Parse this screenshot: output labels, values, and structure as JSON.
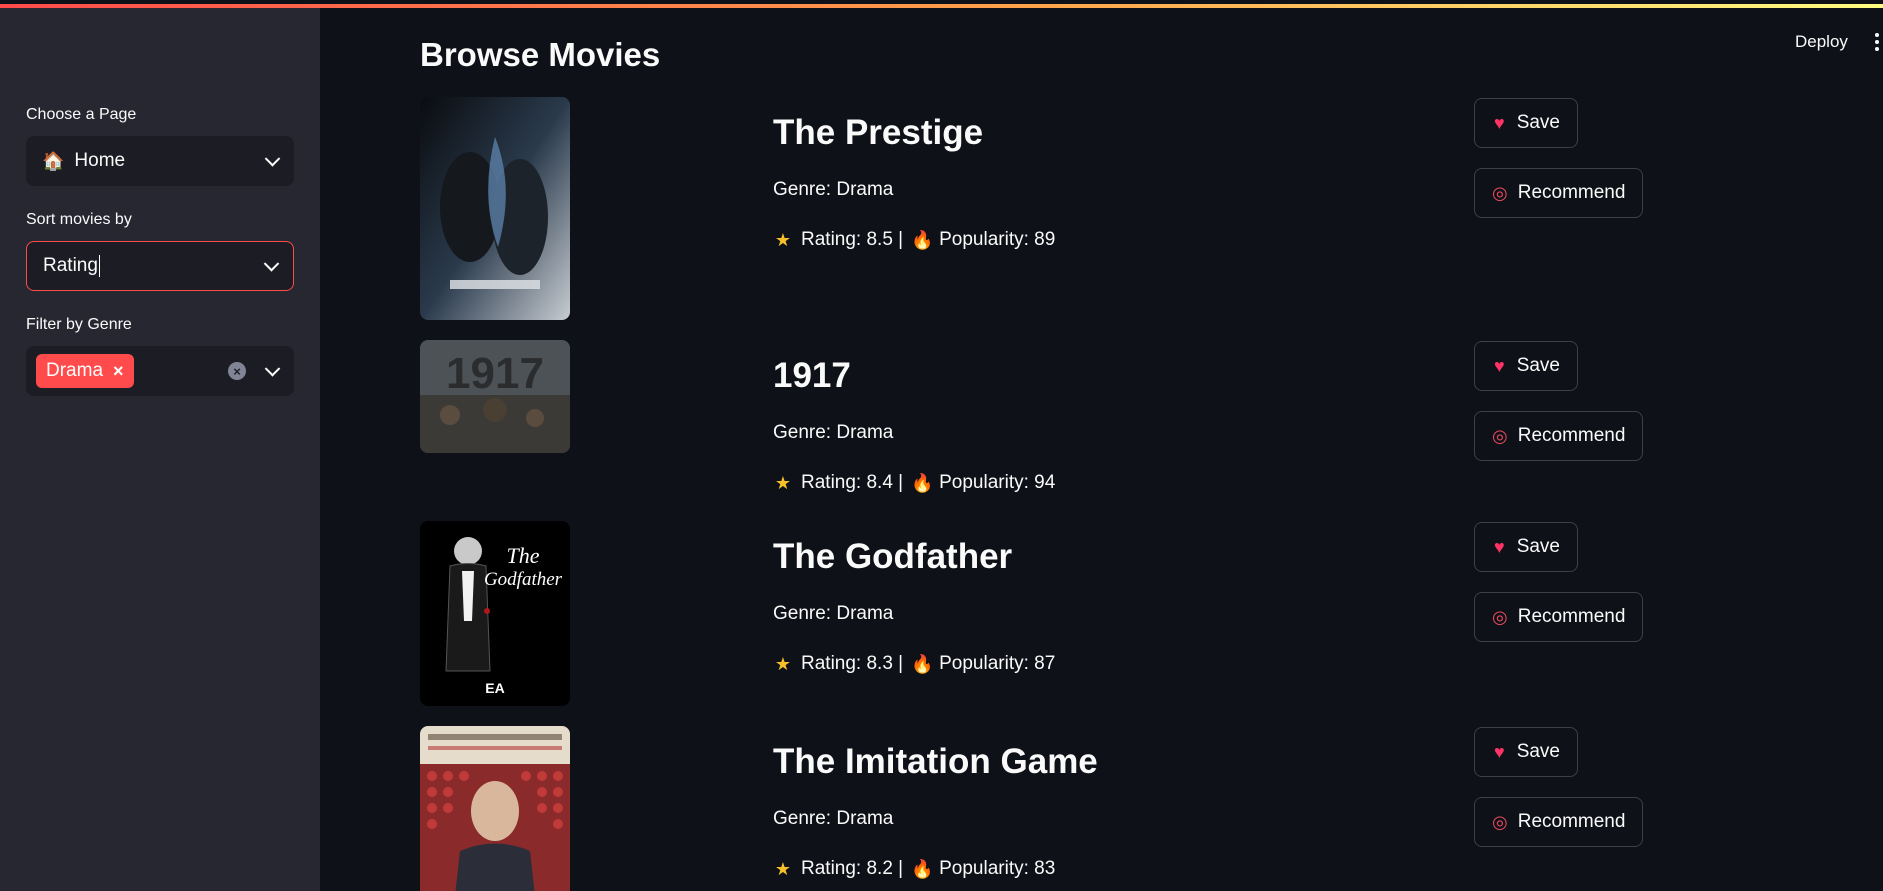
{
  "sidebar": {
    "page_label": "Choose a Page",
    "page_value": "Home",
    "page_icon": "house-icon",
    "sort_label": "Sort movies by",
    "sort_value": "Rating",
    "genre_label": "Filter by Genre",
    "genre_tag": "Drama",
    "genre_tag_remove": "×"
  },
  "header": {
    "title": "Browse Movies",
    "deploy_label": "Deploy"
  },
  "buttons": {
    "save_label": "Save",
    "recommend_label": "Recommend"
  },
  "movies": [
    {
      "title": "The Prestige",
      "genre": "Genre: Drama",
      "rating": "Rating: 8.5 |",
      "popularity": "Popularity: 89",
      "poster_accent": "#4a6d8c"
    },
    {
      "title": "1917",
      "genre": "Genre: Drama",
      "rating": "Rating: 8.4 |",
      "popularity": "Popularity: 94",
      "poster_accent": "#6b6f74"
    },
    {
      "title": "The Godfather",
      "genre": "Genre: Drama",
      "rating": "Rating: 8.3 |",
      "popularity": "Popularity: 87",
      "poster_accent": "#000000"
    },
    {
      "title": "The Imitation Game",
      "genre": "Genre: Drama",
      "rating": "Rating: 8.2 |",
      "popularity": "Popularity: 83",
      "poster_accent": "#b8262b"
    }
  ],
  "colors": {
    "accent": "#ff4b4b",
    "background": "#0e1117",
    "sidebar": "#262730"
  }
}
